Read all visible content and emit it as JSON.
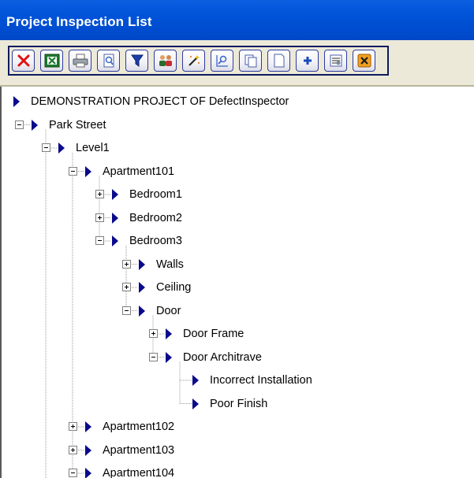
{
  "window": {
    "title": "Project Inspection List"
  },
  "toolbar": {
    "buttons": [
      {
        "name": "delete-button",
        "icon": "red-x-icon"
      },
      {
        "name": "excel-export-button",
        "icon": "excel-icon"
      },
      {
        "name": "print-button",
        "icon": "printer-icon"
      },
      {
        "name": "preview-button",
        "icon": "magnify-page-icon"
      },
      {
        "name": "filter-button",
        "icon": "funnel-icon"
      },
      {
        "name": "users-button",
        "icon": "people-icon"
      },
      {
        "name": "wand-button",
        "icon": "wand-icon"
      },
      {
        "name": "zoom-button",
        "icon": "zoom-icon"
      },
      {
        "name": "copy-button",
        "icon": "copy-pages-icon"
      },
      {
        "name": "new-page-button",
        "icon": "blank-page-icon"
      },
      {
        "name": "add-button",
        "icon": "plus-icon"
      },
      {
        "name": "properties-button",
        "icon": "properties-icon"
      },
      {
        "name": "close-button",
        "icon": "orange-x-icon"
      }
    ]
  },
  "tree": {
    "nodes": [
      {
        "label": "DEMONSTRATION PROJECT OF DefectInspector",
        "level": 0,
        "expander": "none"
      },
      {
        "label": "Park Street",
        "level": 1,
        "expander": "minus"
      },
      {
        "label": "Level1",
        "level": 2,
        "expander": "minus"
      },
      {
        "label": "Apartment101",
        "level": 3,
        "expander": "minus"
      },
      {
        "label": "Bedroom1",
        "level": 4,
        "expander": "plus"
      },
      {
        "label": "Bedroom2",
        "level": 4,
        "expander": "plus"
      },
      {
        "label": "Bedroom3",
        "level": 4,
        "expander": "minus"
      },
      {
        "label": "Walls",
        "level": 5,
        "expander": "plus"
      },
      {
        "label": "Ceiling",
        "level": 5,
        "expander": "plus"
      },
      {
        "label": "Door",
        "level": 5,
        "expander": "minus"
      },
      {
        "label": "Door Frame",
        "level": 6,
        "expander": "plus"
      },
      {
        "label": "Door Architrave",
        "level": 6,
        "expander": "minus"
      },
      {
        "label": "Incorrect Installation",
        "level": 7,
        "expander": "leaf"
      },
      {
        "label": "Poor Finish",
        "level": 7,
        "expander": "leaf"
      },
      {
        "label": "Apartment102",
        "level": 3,
        "expander": "plus"
      },
      {
        "label": "Apartment103",
        "level": 3,
        "expander": "plus"
      },
      {
        "label": "Apartment104",
        "level": 3,
        "expander": "minus"
      }
    ]
  }
}
